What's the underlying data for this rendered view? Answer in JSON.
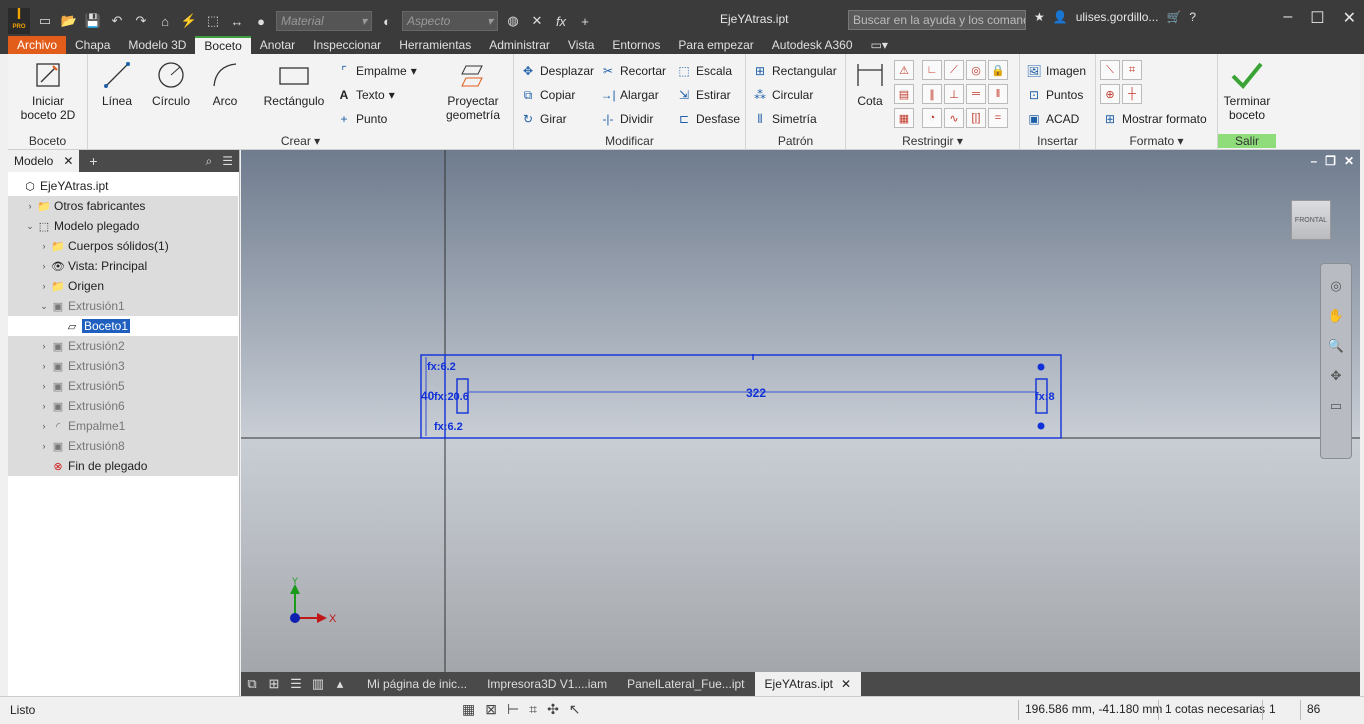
{
  "window": {
    "title": "EjeYAtras.ipt",
    "material_placeholder": "Material",
    "appearance_placeholder": "Aspecto",
    "help_search_placeholder": "Buscar en la ayuda y los comand",
    "user_name": "ulises.gordillo...",
    "logo_text": "I",
    "logo_sub": "PRO"
  },
  "tabs": [
    "Archivo",
    "Chapa",
    "Modelo 3D",
    "Boceto",
    "Anotar",
    "Inspeccionar",
    "Herramientas",
    "Administrar",
    "Vista",
    "Entornos",
    "Para empezar",
    "Autodesk A360"
  ],
  "active_tab": "Boceto",
  "ribbon": {
    "boceto": {
      "title": "Boceto",
      "start_sketch": "Iniciar boceto 2D"
    },
    "crear": {
      "title": "Crear",
      "line": "Línea",
      "circle": "Círculo",
      "arc": "Arco",
      "rectangle": "Rectángulo",
      "fillet": "Empalme",
      "text": "Texto",
      "point": "Punto",
      "project": "Proyectar geometría"
    },
    "modificar": {
      "title": "Modificar",
      "move": "Desplazar",
      "copy": "Copiar",
      "rotate": "Girar",
      "trim": "Recortar",
      "extend": "Alargar",
      "split": "Dividir",
      "scale": "Escala",
      "stretch": "Estirar",
      "offset": "Desfase"
    },
    "patron": {
      "title": "Patrón",
      "rect": "Rectangular",
      "circ": "Circular",
      "mirror": "Simetría"
    },
    "restringir": {
      "title": "Restringir",
      "dimension": "Cota"
    },
    "insertar": {
      "title": "Insertar",
      "image": "Imagen",
      "points": "Puntos",
      "acad": "ACAD"
    },
    "formato": {
      "title": "Formato",
      "show_format": "Mostrar formato"
    },
    "salir": {
      "title": "Salir",
      "finish": "Terminar boceto"
    }
  },
  "browser": {
    "tab": "Modelo",
    "items": [
      {
        "label": "EjeYAtras.ipt",
        "level": 0,
        "icon": "part-icon",
        "style": ""
      },
      {
        "label": "Otros fabricantes",
        "level": 1,
        "icon": "folder-icon",
        "style": "grey"
      },
      {
        "label": "Modelo plegado",
        "level": 1,
        "icon": "sheetmetal-icon",
        "style": "grey"
      },
      {
        "label": "Cuerpos sólidos(1)",
        "level": 2,
        "icon": "folder-icon",
        "style": "grey"
      },
      {
        "label": "Vista: Principal",
        "level": 2,
        "icon": "view-icon",
        "style": "grey"
      },
      {
        "label": "Origen",
        "level": 2,
        "icon": "folder-icon",
        "style": "grey"
      },
      {
        "label": "Extrusión1",
        "level": 2,
        "icon": "extrude-icon",
        "style": "grey dim"
      },
      {
        "label": "Boceto1",
        "level": 3,
        "icon": "sketch-icon",
        "style": "selected"
      },
      {
        "label": "Extrusión2",
        "level": 2,
        "icon": "extrude-icon",
        "style": "grey dim"
      },
      {
        "label": "Extrusión3",
        "level": 2,
        "icon": "extrude-icon",
        "style": "grey dim"
      },
      {
        "label": "Extrusión5",
        "level": 2,
        "icon": "extrude-icon",
        "style": "grey dim"
      },
      {
        "label": "Extrusión6",
        "level": 2,
        "icon": "extrude-icon",
        "style": "grey dim"
      },
      {
        "label": "Empalme1",
        "level": 2,
        "icon": "fillet-icon",
        "style": "grey dim"
      },
      {
        "label": "Extrusión8",
        "level": 2,
        "icon": "extrude-icon",
        "style": "grey dim"
      },
      {
        "label": "Fin de plegado",
        "level": 2,
        "icon": "end-of-fold-icon",
        "style": "grey"
      }
    ]
  },
  "sketch": {
    "dimension_length": "322",
    "dimension_height": "40",
    "label_fx1": "fx:6.2",
    "label_fx2": "fx:20.6",
    "label_fx3": "fx:6.2",
    "label_fx4": "fx:8",
    "sketch_color": "#1030d8"
  },
  "viewcube": {
    "label": "FRONTAL"
  },
  "doc_tabs": [
    "Mi página de inic...",
    "Impresora3D V1....iam",
    "PanelLateral_Fue...ipt",
    "EjeYAtras.ipt"
  ],
  "active_doc": "EjeYAtras.ipt",
  "status": {
    "text": "Listo",
    "coords": "196.586 mm, -41.180 mm",
    "dims_needed": "1 cotas necesarias",
    "field1": "1",
    "field2": "86"
  },
  "colors": {
    "accent_green": "#3c9e3c",
    "file_tab": "#e35d1a",
    "salir_title": "#8fdc7a",
    "selection": "#1e5fbf"
  }
}
